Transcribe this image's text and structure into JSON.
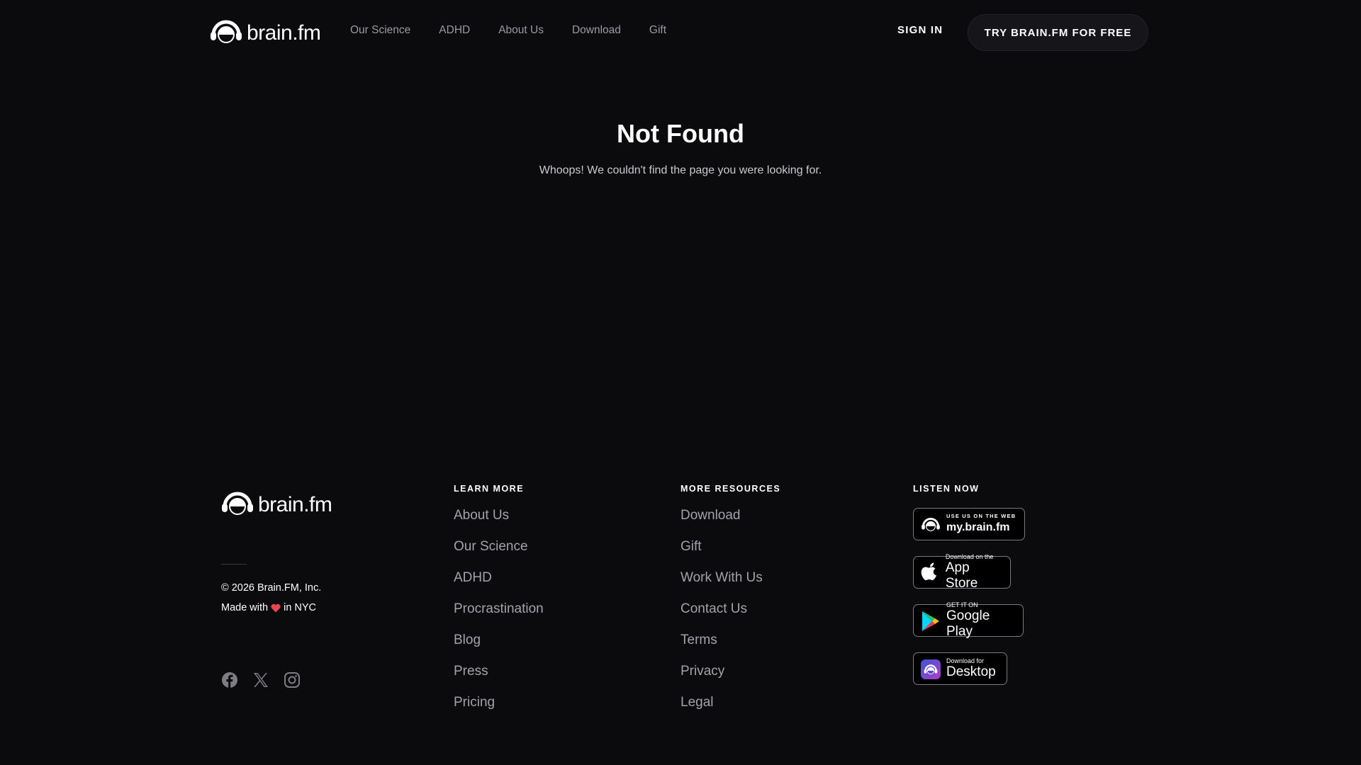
{
  "header": {
    "logo_text": "brain.fm",
    "nav": [
      "Our Science",
      "ADHD",
      "About Us",
      "Download",
      "Gift"
    ],
    "sign_in": "SIGN IN",
    "cta": "TRY BRAIN.FM FOR FREE"
  },
  "main": {
    "title": "Not Found",
    "subtitle": "Whoops! We couldn't find the page you were looking for."
  },
  "footer": {
    "logo_text": "brain.fm",
    "copyright": "© 2026 Brain.FM, Inc.",
    "made_with_prefix": "Made with",
    "made_with_suffix": "in NYC",
    "socials": [
      "facebook-icon",
      "x-icon",
      "instagram-icon"
    ],
    "learn_more": {
      "heading": "LEARN MORE",
      "links": [
        "About Us",
        "Our Science",
        "ADHD",
        "Procrastination",
        "Blog",
        "Press",
        "Pricing"
      ]
    },
    "more_resources": {
      "heading": "MORE RESOURCES",
      "links": [
        "Download",
        "Gift",
        "Work With Us",
        "Contact Us",
        "Terms",
        "Privacy",
        "Legal"
      ]
    },
    "listen_now": {
      "heading": "LISTEN NOW",
      "badges": [
        {
          "small": "USE US ON THE WEB",
          "big": "my.brain.fm"
        },
        {
          "small": "Download on the",
          "big": "App Store"
        },
        {
          "small": "GET IT ON",
          "big": "Google Play"
        },
        {
          "small": "Download for",
          "big": "Desktop"
        }
      ]
    }
  },
  "colors": {
    "background": "#0b0b0e",
    "heart": "#e5484d",
    "muted_text": "#a2a2aa"
  }
}
